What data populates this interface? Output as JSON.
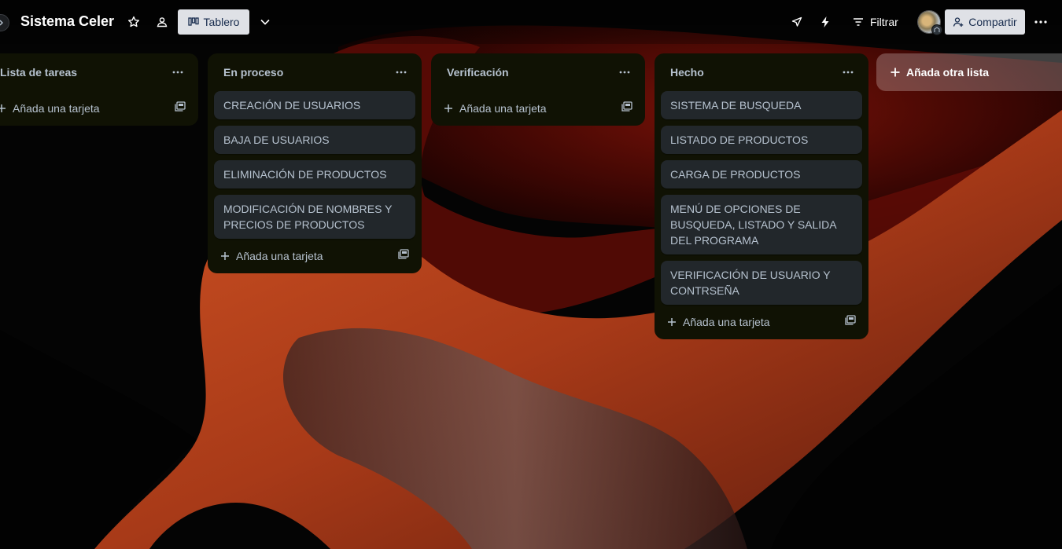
{
  "header": {
    "board_title": "Sistema Celer",
    "view_label": "Tablero",
    "filter_label": "Filtrar",
    "share_label": "Compartir"
  },
  "icons": {
    "collapse": "chevron-right-icon",
    "star": "star-icon",
    "workspace_visibility": "people-icon",
    "board_view": "board-icon",
    "view_switch": "chevron-down-icon",
    "power_ups": "rocket-icon",
    "automation": "lightning-icon",
    "filter": "filter-icon",
    "share": "add-person-icon",
    "more": "more-horizontal-icon",
    "add": "plus-icon",
    "template": "card-template-icon"
  },
  "lists": [
    {
      "title": "Lista de tareas",
      "cards": [],
      "add_card_label": "Añada una tarjeta"
    },
    {
      "title": "En proceso",
      "cards": [
        "CREACIÓN DE USUARIOS",
        "BAJA DE USUARIOS",
        "ELIMINACIÓN DE PRODUCTOS",
        "MODIFICACIÓN DE NOMBRES Y PRECIOS DE PRODUCTOS"
      ],
      "add_card_label": "Añada una tarjeta"
    },
    {
      "title": "Verificación",
      "cards": [],
      "add_card_label": "Añada una tarjeta"
    },
    {
      "title": "Hecho",
      "cards": [
        "SISTEMA DE BUSQUEDA",
        "LISTADO DE PRODUCTOS",
        "CARGA DE PRODUCTOS",
        "MENÚ DE OPCIONES DE BUSQUEDA, LISTADO Y SALIDA DEL PROGRAMA",
        "VERIFICACIÓN DE USUARIO Y CONTRSEÑA"
      ],
      "add_card_label": "Añada una tarjeta"
    }
  ],
  "add_list_label": "Añada otra lista",
  "colors": {
    "list_bg": "#101204",
    "card_bg": "#22272b",
    "text": "#b6c2cf",
    "button_bg": "#dfe1e6",
    "background_accent": "#c2451c"
  }
}
